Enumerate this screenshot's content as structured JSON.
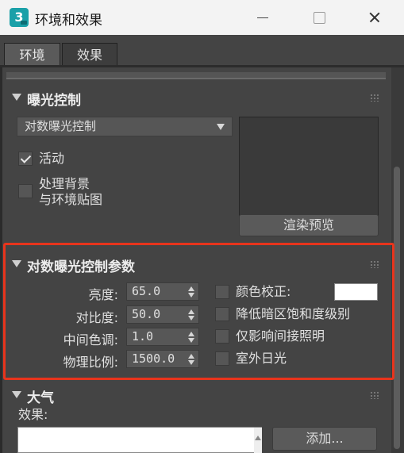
{
  "window": {
    "title": "环境和效果",
    "app_icon_glyph": "3"
  },
  "tabs": [
    {
      "label": "环境",
      "active": true
    },
    {
      "label": "效果",
      "active": false
    }
  ],
  "exposure": {
    "header": "曝光控制",
    "dropdown_value": "对数曝光控制",
    "active_label": "活动",
    "active_checked": true,
    "bg_label_line1": "处理背景",
    "bg_label_line2": "与环境贴图",
    "bg_checked": false,
    "render_preview_label": "渲染预览"
  },
  "log_params": {
    "header": "对数曝光控制参数",
    "brightness_label": "亮度:",
    "brightness_value": "65.0",
    "contrast_label": "对比度:",
    "contrast_value": "50.0",
    "midtones_label": "中间色调:",
    "midtones_value": "1.0",
    "physical_scale_label": "物理比例:",
    "physical_scale_value": "1500.0",
    "color_correction_label": "颜色校正:",
    "color_correction_color": "#ffffff",
    "desaturate_label": "降低暗区饱和度级别",
    "affect_indirect_label": "仅影响间接照明",
    "exterior_daylight_label": "室外日光"
  },
  "atmosphere": {
    "header": "大气",
    "effects_label": "效果:",
    "add_button": "添加..."
  },
  "colors": {
    "highlight_border": "#e8341c",
    "panel_bg": "#444444"
  }
}
